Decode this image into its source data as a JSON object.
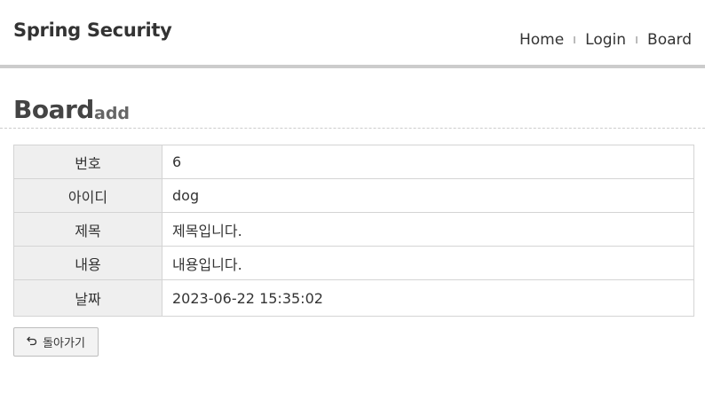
{
  "header": {
    "brand": "Spring Security",
    "nav": [
      {
        "label": "Home"
      },
      {
        "label": "Login"
      },
      {
        "label": "Board"
      }
    ]
  },
  "page": {
    "title": "Board",
    "subtitle": "add"
  },
  "detail": {
    "rows": [
      {
        "label": "번호",
        "value": "6"
      },
      {
        "label": "아이디",
        "value": "dog"
      },
      {
        "label": "제목",
        "value": "제목입니다."
      },
      {
        "label": "내용",
        "value": "내용입니다."
      },
      {
        "label": "날짜",
        "value": "2023-06-22 15:35:02"
      }
    ]
  },
  "actions": {
    "back_label": "돌아가기",
    "back_icon": "undo-arrow-icon"
  }
}
